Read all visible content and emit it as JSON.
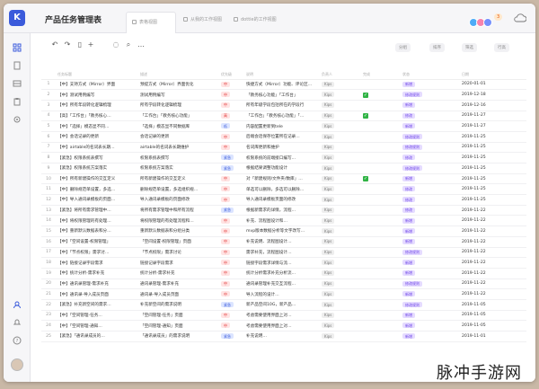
{
  "app": {
    "logo_letter": "K",
    "title": "产品任务管理表",
    "tabs": [
      {
        "label": "表格视图",
        "active": true
      },
      {
        "label": "从我的工作视图",
        "active": false
      },
      {
        "label": "dottie的工作视图",
        "active": false
      }
    ],
    "badge_count": "3"
  },
  "toolbar": {
    "filters": [
      "分组",
      "排序",
      "筛选",
      "行高"
    ]
  },
  "columns": [
    "需求",
    "",
    "编号",
    "",
    "状态",
    "",
    "开发者",
    "",
    "是否",
    "",
    "状态",
    "完成日期"
  ],
  "table": {
    "headers": [
      "",
      "任务标题",
      "描述",
      "优先级",
      "说明",
      "负责人",
      "完成",
      "状态",
      "日期"
    ],
    "rows": [
      {
        "n": "1",
        "title": "【中】支持方式（Mirror）界面",
        "desc": "预提方式（Mirror）界面优化",
        "prio": "中",
        "note": "快捷方式（Mirror）功能、评论区…",
        "owner": "Kips",
        "done": false,
        "status": "新增",
        "date": "2020-01-01"
      },
      {
        "n": "2",
        "title": "【中】测试用例编写",
        "desc": "测试用例编写",
        "prio": "中",
        "note": "「教务核心功能」「工作台」",
        "owner": "Kips",
        "done": true,
        "status": "修改规则",
        "date": "2019-12-18"
      },
      {
        "n": "3",
        "title": "【中】所有年段转化逻辑梳理",
        "desc": "所有学段转化逻辑梳理",
        "prio": "中",
        "note": "所有年级学段包括所在的学段行",
        "owner": "Kips",
        "done": false,
        "status": "新增",
        "date": "2019-12-16"
      },
      {
        "n": "4",
        "title": "【高】「工作台」「教务核心…",
        "desc": "「工作台」「教务核心功能」",
        "prio": "高",
        "note": "「工作台」「教务核心功能」「…",
        "owner": "Kips",
        "done": true,
        "status": "修改",
        "date": "2019-11-27"
      },
      {
        "n": "5",
        "title": "【中】「选择」模态显不同…",
        "desc": "「选择」模态显不同数据库",
        "prio": "低",
        "note": "内容配置更新到tele",
        "owner": "Kips",
        "done": false,
        "status": "新增",
        "date": "2019-11-27"
      },
      {
        "n": "6",
        "title": "【中】会话记录的更新",
        "desc": "会话记录的更新",
        "prio": "中",
        "note": "后端会话保存位置所在记录…",
        "owner": "Kips",
        "done": false,
        "status": "修改规则",
        "date": "2019-11-25"
      },
      {
        "n": "7",
        "title": "【中】airtable的名词表长期…",
        "desc": "airtable的名词表长期维护",
        "prio": "中",
        "note": "名词库更新和维护",
        "owner": "Kips",
        "done": false,
        "status": "修改规则",
        "date": "2019-11-25"
      },
      {
        "n": "8",
        "title": "【紧急】权限系统表撰写",
        "desc": "权限系统表撰写",
        "prio": "紧急",
        "note": "权限系统的前端接口编写…",
        "owner": "Kips",
        "done": false,
        "status": "修改",
        "date": "2019-11-25"
      },
      {
        "n": "9",
        "title": "【紧急】权限系统方案落实",
        "desc": "权限系统方案落实",
        "prio": "紧急",
        "note": "根据结果调整功能设计",
        "owner": "Kips",
        "done": false,
        "status": "修改规则",
        "date": "2019-11-25"
      },
      {
        "n": "10",
        "title": "【中】所有新建操作的交互定义",
        "desc": "所有新建操作的交互定义",
        "prio": "中",
        "note": "对「新建规则/文件夹/数库」…",
        "owner": "Kips",
        "done": true,
        "status": "新增",
        "date": "2019-11-25"
      },
      {
        "n": "11",
        "title": "【中】删除规范单设置，多选…",
        "desc": "删除规范单设置，多选组织规…",
        "prio": "中",
        "note": "单选可以删除，多选可以删除…",
        "owner": "Kips",
        "done": false,
        "status": "修改",
        "date": "2019-11-25"
      },
      {
        "n": "12",
        "title": "【中】导入通讯录模板的页面…",
        "desc": "导入通讯录模板的页面修改",
        "prio": "中",
        "note": "导入通讯录模板页面的修改",
        "owner": "Kips",
        "done": false,
        "status": "修改",
        "date": "2019-11-25"
      },
      {
        "n": "13",
        "title": "【紧急】将所有需求管理中…",
        "desc": "将所有需求管理中和所有流程",
        "prio": "紧急",
        "note": "根据新需求的详情，流程…",
        "owner": "Kips",
        "done": false,
        "status": "修改",
        "date": "2019-11-22"
      },
      {
        "n": "14",
        "title": "【中】将权限管理的有处理…",
        "desc": "将权限管理的有处理流程和…",
        "prio": "中",
        "note": "补充、流程图设计和…",
        "owner": "Kips",
        "done": false,
        "status": "新增",
        "date": "2019-11-22"
      },
      {
        "n": "15",
        "title": "【中】重新默认数据表和分…",
        "desc": "重新默认数据表和分组分类",
        "prio": "中",
        "note": "mvp版本数据分析等文字改写…",
        "owner": "Kips",
        "done": false,
        "status": "新增",
        "date": "2019-11-22"
      },
      {
        "n": "16",
        "title": "【中】「空间设置-权限管理」",
        "desc": "「空间设置-权限管理」页面",
        "prio": "中",
        "note": "补充说明、流程图设计…",
        "owner": "Kips",
        "done": false,
        "status": "新增",
        "date": "2019-11-22"
      },
      {
        "n": "17",
        "title": "【中】「节点权限」需求讨…",
        "desc": "「节点权限」需求讨论",
        "prio": "中",
        "note": "需求补充，流程图设计…",
        "owner": "Kips",
        "done": false,
        "status": "修改规则",
        "date": "2019-11-22"
      },
      {
        "n": "18",
        "title": "【中】链接记录字段需求",
        "desc": "链接记录字段需求",
        "prio": "中",
        "note": "链接字段需求详情与流…",
        "owner": "Kips",
        "done": false,
        "status": "新增",
        "date": "2019-11-22"
      },
      {
        "n": "19",
        "title": "【中】统计分析-需求补充",
        "desc": "统计分析-需求补充",
        "prio": "中",
        "note": "统计分析需求补充分析流…",
        "owner": "Kips",
        "done": false,
        "status": "新增",
        "date": "2019-11-22"
      },
      {
        "n": "20",
        "title": "【中】通讯录管理-需求补充",
        "desc": "通讯录管理-需求补充",
        "prio": "中",
        "note": "通讯录管理补充交互流程…",
        "owner": "Kips",
        "done": false,
        "status": "修改规则",
        "date": "2019-11-22"
      },
      {
        "n": "21",
        "title": "【中】通讯录-导入成员页面",
        "desc": "通讯录-导入成员页面",
        "prio": "中",
        "note": "导入流程的设计…",
        "owner": "Kips",
        "done": false,
        "status": "新增",
        "date": "2019-11-22"
      },
      {
        "n": "22",
        "title": "【紧急】补充新空间的需求…",
        "desc": "补充新空间的需求说明",
        "prio": "紧急",
        "note": "新产品空间10G，新产品…",
        "owner": "Kips",
        "done": false,
        "status": "修改规则",
        "date": "2019-11-05"
      },
      {
        "n": "23",
        "title": "【中】「空间管理-任务…",
        "desc": "「空间管理-任务」页面",
        "prio": "中",
        "note": "考虑需要使用界面上对…",
        "owner": "Kips",
        "done": false,
        "status": "新增",
        "date": "2019-11-05"
      },
      {
        "n": "24",
        "title": "【中】「空间管理-通知…",
        "desc": "「空间管理-通知」页面",
        "prio": "中",
        "note": "考虑需要使用界面上对…",
        "owner": "Kips",
        "done": false,
        "status": "新增",
        "date": "2019-11-05"
      },
      {
        "n": "25",
        "title": "【紧急】「通讯录成员的…",
        "desc": "「通讯录成员」的需求说明",
        "prio": "紧急",
        "note": "补充说明…",
        "owner": "Kips",
        "done": false,
        "status": "新增",
        "date": "2019-11-01"
      }
    ]
  },
  "watermark": "脉冲手游网"
}
